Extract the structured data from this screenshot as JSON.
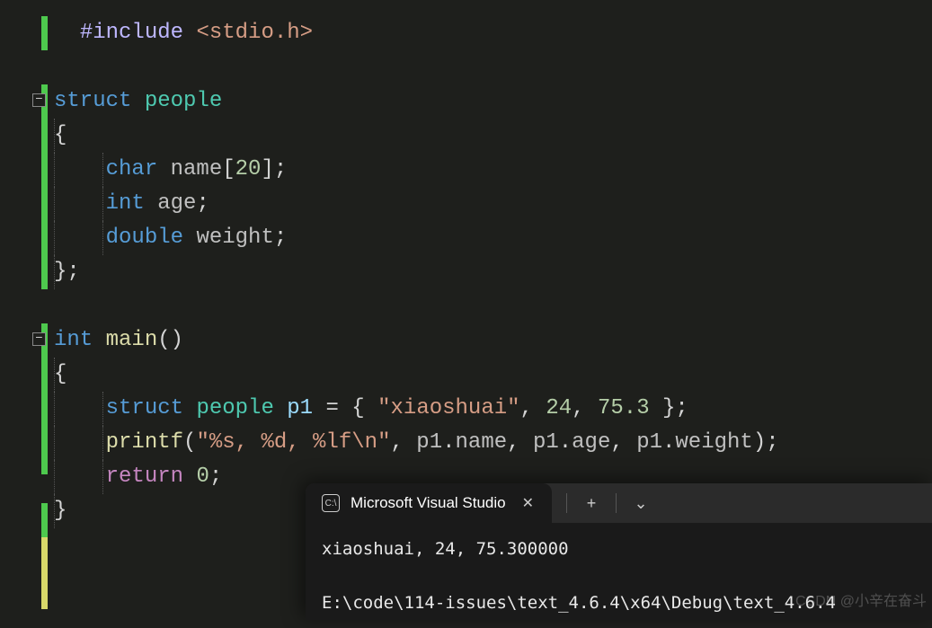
{
  "code": {
    "include": {
      "directive": "#include",
      "path": "<stdio.h>"
    },
    "struct_kw": "struct",
    "struct_name": "people",
    "open_brace": "{",
    "close_brace_semi": "};",
    "char_kw": "char",
    "name_field": "name",
    "name_dim_open": "[",
    "name_dim": "20",
    "name_dim_close": "]",
    "int_kw": "int",
    "age_field": "age",
    "double_kw": "double",
    "weight_field": "weight",
    "semi": ";",
    "main_kw": "int",
    "main_name": "main",
    "parens": "()",
    "p1_struct": "struct",
    "p1_type": "people",
    "p1_name": "p1",
    "eq": " = ",
    "init_open": "{ ",
    "str1": "\"xiaoshuai\"",
    "comma": ", ",
    "lit1": "24",
    "lit2": "75.3",
    "init_close": " }",
    "printf": "printf",
    "fmt": "\"%s, %d, %lf\\n\"",
    "p1a": "p1",
    "dot": ".",
    "name_acc": "name",
    "age_acc": "age",
    "weight_acc": "weight",
    "return_kw": "return",
    "return_val": "0"
  },
  "terminal": {
    "tab_title": "Microsoft Visual Studio",
    "tab_icon_text": "C:\\",
    "output_line1": "xiaoshuai, 24, 75.300000",
    "output_line2": "E:\\code\\114-issues\\text_4.6.4\\x64\\Debug\\text_4.6.4",
    "plus": "+",
    "chevron": "⌄"
  },
  "watermark": "CSDN @小辛在奋斗"
}
